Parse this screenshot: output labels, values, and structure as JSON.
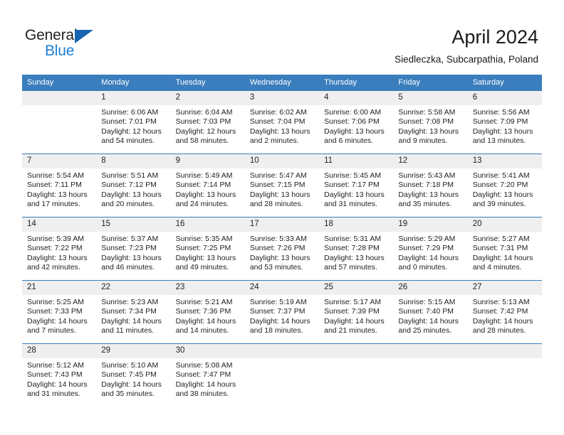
{
  "logo": {
    "word_one": "General",
    "word_two": "Blue",
    "triangle_color": "#1565b0",
    "blue_color": "#1a7fd4"
  },
  "header": {
    "title": "April 2024",
    "subtitle": "Siedleczka, Subcarpathia, Poland"
  },
  "theme": {
    "header_blue": "#3a7ebe",
    "daynum_gray": "#efefef",
    "text": "#222222"
  },
  "calendar": {
    "weekday_headers": [
      "Sunday",
      "Monday",
      "Tuesday",
      "Wednesday",
      "Thursday",
      "Friday",
      "Saturday"
    ],
    "weeks": [
      [
        {
          "day": "",
          "sunrise": "",
          "sunset": "",
          "daylight_1": "",
          "daylight_2": ""
        },
        {
          "day": "1",
          "sunrise": "Sunrise: 6:06 AM",
          "sunset": "Sunset: 7:01 PM",
          "daylight_1": "Daylight: 12 hours",
          "daylight_2": "and 54 minutes."
        },
        {
          "day": "2",
          "sunrise": "Sunrise: 6:04 AM",
          "sunset": "Sunset: 7:03 PM",
          "daylight_1": "Daylight: 12 hours",
          "daylight_2": "and 58 minutes."
        },
        {
          "day": "3",
          "sunrise": "Sunrise: 6:02 AM",
          "sunset": "Sunset: 7:04 PM",
          "daylight_1": "Daylight: 13 hours",
          "daylight_2": "and 2 minutes."
        },
        {
          "day": "4",
          "sunrise": "Sunrise: 6:00 AM",
          "sunset": "Sunset: 7:06 PM",
          "daylight_1": "Daylight: 13 hours",
          "daylight_2": "and 6 minutes."
        },
        {
          "day": "5",
          "sunrise": "Sunrise: 5:58 AM",
          "sunset": "Sunset: 7:08 PM",
          "daylight_1": "Daylight: 13 hours",
          "daylight_2": "and 9 minutes."
        },
        {
          "day": "6",
          "sunrise": "Sunrise: 5:56 AM",
          "sunset": "Sunset: 7:09 PM",
          "daylight_1": "Daylight: 13 hours",
          "daylight_2": "and 13 minutes."
        }
      ],
      [
        {
          "day": "7",
          "sunrise": "Sunrise: 5:54 AM",
          "sunset": "Sunset: 7:11 PM",
          "daylight_1": "Daylight: 13 hours",
          "daylight_2": "and 17 minutes."
        },
        {
          "day": "8",
          "sunrise": "Sunrise: 5:51 AM",
          "sunset": "Sunset: 7:12 PM",
          "daylight_1": "Daylight: 13 hours",
          "daylight_2": "and 20 minutes."
        },
        {
          "day": "9",
          "sunrise": "Sunrise: 5:49 AM",
          "sunset": "Sunset: 7:14 PM",
          "daylight_1": "Daylight: 13 hours",
          "daylight_2": "and 24 minutes."
        },
        {
          "day": "10",
          "sunrise": "Sunrise: 5:47 AM",
          "sunset": "Sunset: 7:15 PM",
          "daylight_1": "Daylight: 13 hours",
          "daylight_2": "and 28 minutes."
        },
        {
          "day": "11",
          "sunrise": "Sunrise: 5:45 AM",
          "sunset": "Sunset: 7:17 PM",
          "daylight_1": "Daylight: 13 hours",
          "daylight_2": "and 31 minutes."
        },
        {
          "day": "12",
          "sunrise": "Sunrise: 5:43 AM",
          "sunset": "Sunset: 7:18 PM",
          "daylight_1": "Daylight: 13 hours",
          "daylight_2": "and 35 minutes."
        },
        {
          "day": "13",
          "sunrise": "Sunrise: 5:41 AM",
          "sunset": "Sunset: 7:20 PM",
          "daylight_1": "Daylight: 13 hours",
          "daylight_2": "and 39 minutes."
        }
      ],
      [
        {
          "day": "14",
          "sunrise": "Sunrise: 5:39 AM",
          "sunset": "Sunset: 7:22 PM",
          "daylight_1": "Daylight: 13 hours",
          "daylight_2": "and 42 minutes."
        },
        {
          "day": "15",
          "sunrise": "Sunrise: 5:37 AM",
          "sunset": "Sunset: 7:23 PM",
          "daylight_1": "Daylight: 13 hours",
          "daylight_2": "and 46 minutes."
        },
        {
          "day": "16",
          "sunrise": "Sunrise: 5:35 AM",
          "sunset": "Sunset: 7:25 PM",
          "daylight_1": "Daylight: 13 hours",
          "daylight_2": "and 49 minutes."
        },
        {
          "day": "17",
          "sunrise": "Sunrise: 5:33 AM",
          "sunset": "Sunset: 7:26 PM",
          "daylight_1": "Daylight: 13 hours",
          "daylight_2": "and 53 minutes."
        },
        {
          "day": "18",
          "sunrise": "Sunrise: 5:31 AM",
          "sunset": "Sunset: 7:28 PM",
          "daylight_1": "Daylight: 13 hours",
          "daylight_2": "and 57 minutes."
        },
        {
          "day": "19",
          "sunrise": "Sunrise: 5:29 AM",
          "sunset": "Sunset: 7:29 PM",
          "daylight_1": "Daylight: 14 hours",
          "daylight_2": "and 0 minutes."
        },
        {
          "day": "20",
          "sunrise": "Sunrise: 5:27 AM",
          "sunset": "Sunset: 7:31 PM",
          "daylight_1": "Daylight: 14 hours",
          "daylight_2": "and 4 minutes."
        }
      ],
      [
        {
          "day": "21",
          "sunrise": "Sunrise: 5:25 AM",
          "sunset": "Sunset: 7:33 PM",
          "daylight_1": "Daylight: 14 hours",
          "daylight_2": "and 7 minutes."
        },
        {
          "day": "22",
          "sunrise": "Sunrise: 5:23 AM",
          "sunset": "Sunset: 7:34 PM",
          "daylight_1": "Daylight: 14 hours",
          "daylight_2": "and 11 minutes."
        },
        {
          "day": "23",
          "sunrise": "Sunrise: 5:21 AM",
          "sunset": "Sunset: 7:36 PM",
          "daylight_1": "Daylight: 14 hours",
          "daylight_2": "and 14 minutes."
        },
        {
          "day": "24",
          "sunrise": "Sunrise: 5:19 AM",
          "sunset": "Sunset: 7:37 PM",
          "daylight_1": "Daylight: 14 hours",
          "daylight_2": "and 18 minutes."
        },
        {
          "day": "25",
          "sunrise": "Sunrise: 5:17 AM",
          "sunset": "Sunset: 7:39 PM",
          "daylight_1": "Daylight: 14 hours",
          "daylight_2": "and 21 minutes."
        },
        {
          "day": "26",
          "sunrise": "Sunrise: 5:15 AM",
          "sunset": "Sunset: 7:40 PM",
          "daylight_1": "Daylight: 14 hours",
          "daylight_2": "and 25 minutes."
        },
        {
          "day": "27",
          "sunrise": "Sunrise: 5:13 AM",
          "sunset": "Sunset: 7:42 PM",
          "daylight_1": "Daylight: 14 hours",
          "daylight_2": "and 28 minutes."
        }
      ],
      [
        {
          "day": "28",
          "sunrise": "Sunrise: 5:12 AM",
          "sunset": "Sunset: 7:43 PM",
          "daylight_1": "Daylight: 14 hours",
          "daylight_2": "and 31 minutes."
        },
        {
          "day": "29",
          "sunrise": "Sunrise: 5:10 AM",
          "sunset": "Sunset: 7:45 PM",
          "daylight_1": "Daylight: 14 hours",
          "daylight_2": "and 35 minutes."
        },
        {
          "day": "30",
          "sunrise": "Sunrise: 5:08 AM",
          "sunset": "Sunset: 7:47 PM",
          "daylight_1": "Daylight: 14 hours",
          "daylight_2": "and 38 minutes."
        },
        {
          "day": "",
          "sunrise": "",
          "sunset": "",
          "daylight_1": "",
          "daylight_2": ""
        },
        {
          "day": "",
          "sunrise": "",
          "sunset": "",
          "daylight_1": "",
          "daylight_2": ""
        },
        {
          "day": "",
          "sunrise": "",
          "sunset": "",
          "daylight_1": "",
          "daylight_2": ""
        },
        {
          "day": "",
          "sunrise": "",
          "sunset": "",
          "daylight_1": "",
          "daylight_2": ""
        }
      ]
    ]
  }
}
